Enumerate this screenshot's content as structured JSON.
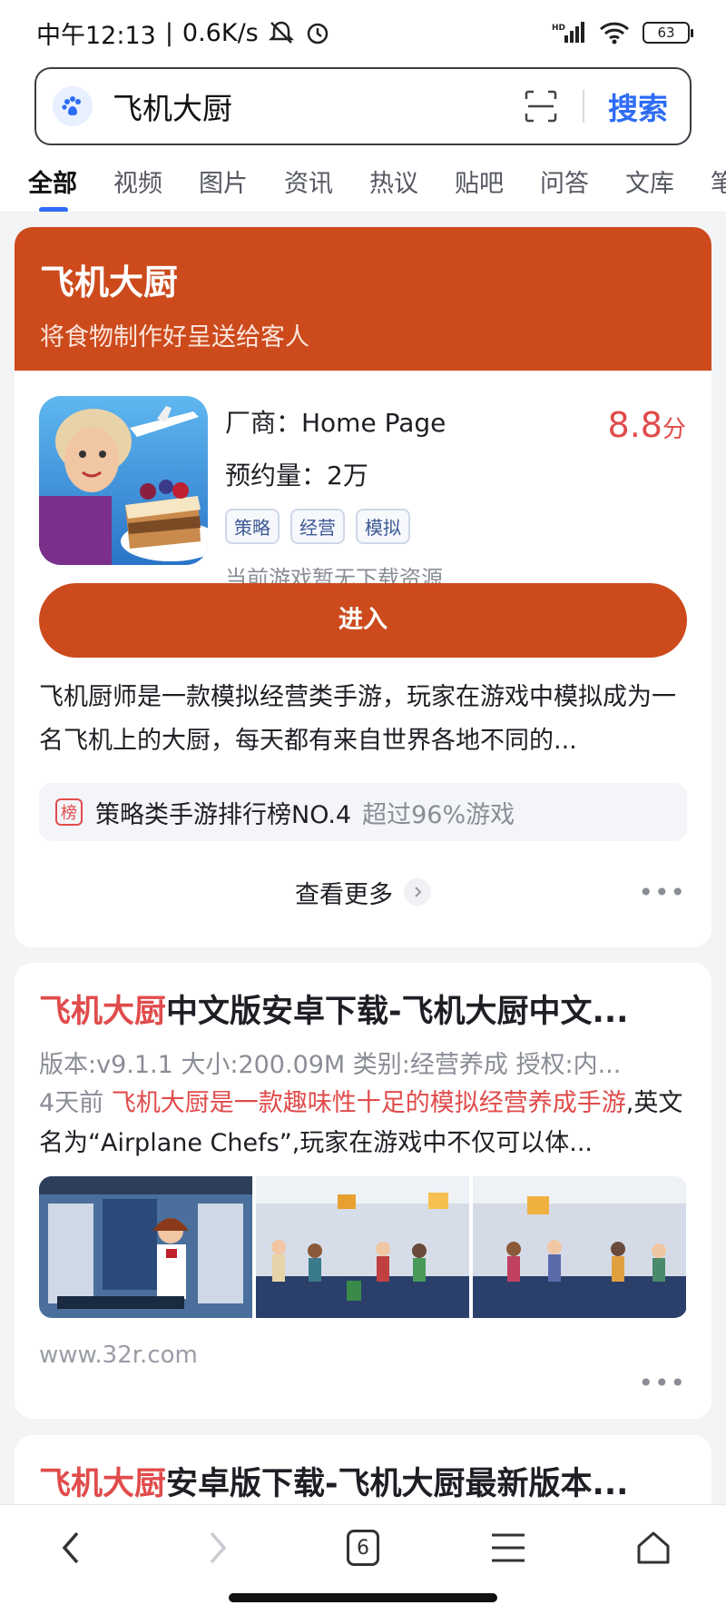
{
  "status_bar": {
    "time": "中午12:13",
    "speed": "0.6K/s",
    "battery": "63"
  },
  "search": {
    "query": "飞机大厨",
    "button": "搜索"
  },
  "tabs": [
    "全部",
    "视频",
    "图片",
    "资讯",
    "热议",
    "贴吧",
    "问答",
    "文库",
    "笔"
  ],
  "game_card": {
    "title": "飞机大厨",
    "slogan": "将食物制作好呈送给客人",
    "vendor": "厂商：Home Page",
    "reservations": "预约量：2万",
    "score": "8.8",
    "score_unit": "分",
    "tags": [
      "策略",
      "经营",
      "模拟"
    ],
    "note": "当前游戏暂无下载资源",
    "enter_button": "进入",
    "description": "飞机厨师是一款模拟经营类手游，玩家在游戏中模拟成为一名飞机上的大厨，每天都有来自世界各地不同的...",
    "rank_badge": "榜",
    "rank_text": "策略类手游排行榜NO.4",
    "rank_sub": "超过96%游戏",
    "more": "查看更多"
  },
  "result1": {
    "title_hl": "飞机大厨",
    "title_rest": "中文版安卓下载-飞机大厨中文...",
    "meta": "版本:v9.1.1   大小:200.09M   类别:经营养成   授权:内...",
    "date": "4天前",
    "snippet_hl": "飞机大厨是一款趣味性十足的模拟经营养成手游",
    "snippet_rest": ",英文名为“Airplane Chefs”,玩家在游戏中不仅可以体...",
    "source": "www.32r.com"
  },
  "result2": {
    "title_hl": "飞机大厨",
    "title_rest": "安卓版下载-飞机大厨最新版本..."
  },
  "bottom_nav": {
    "tab_count": "6"
  },
  "colors": {
    "accent_blue": "#2d6cf6",
    "brand_orange": "#cc4a1c",
    "highlight_red": "#e14b4b"
  }
}
